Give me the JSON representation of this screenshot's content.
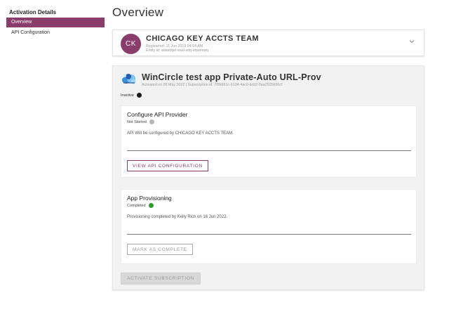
{
  "sidebar": {
    "title": "Activation Details",
    "items": [
      {
        "label": "Overview",
        "active": true
      },
      {
        "label": "API Configuration",
        "active": false
      }
    ]
  },
  "page": {
    "title": "Overview"
  },
  "team": {
    "initials": "CK",
    "name": "CHICAGO KEY ACCTS TEAM",
    "registered": "Registered: 11 Jun 2019 04:54 AM",
    "entity": "Entity id: adasdqei-wad-sdq-eqweewq"
  },
  "subscription": {
    "app_name": "WinCircle test app Private-Auto URL-Prov",
    "activated": "Activated on 06 May 2022 | Subscription id: 7f9b961c-6104-4ac0-bcb2-0aa2535696cf",
    "status_label": "Inactive",
    "status_color": "#1a1a1a",
    "activate_button": "ACTIVATE SUBSCRIPTION"
  },
  "api_provider": {
    "title": "Configure API Provider",
    "status": "Not Started",
    "status_color": "#b5b5b5",
    "description": "API Will be configured by CHICAGO KEY ACCTS TEAM.",
    "button": "VIEW API CONFIGURATION"
  },
  "provisioning": {
    "title": "App Provisioning",
    "status": "Completed",
    "status_color": "#2e9b2e",
    "description": "Provisioning completed by Kelly Rich on 16 Jun 2022.",
    "button": "MARK AS COMPLETE"
  },
  "colors": {
    "accent": "#8a3c6b"
  }
}
